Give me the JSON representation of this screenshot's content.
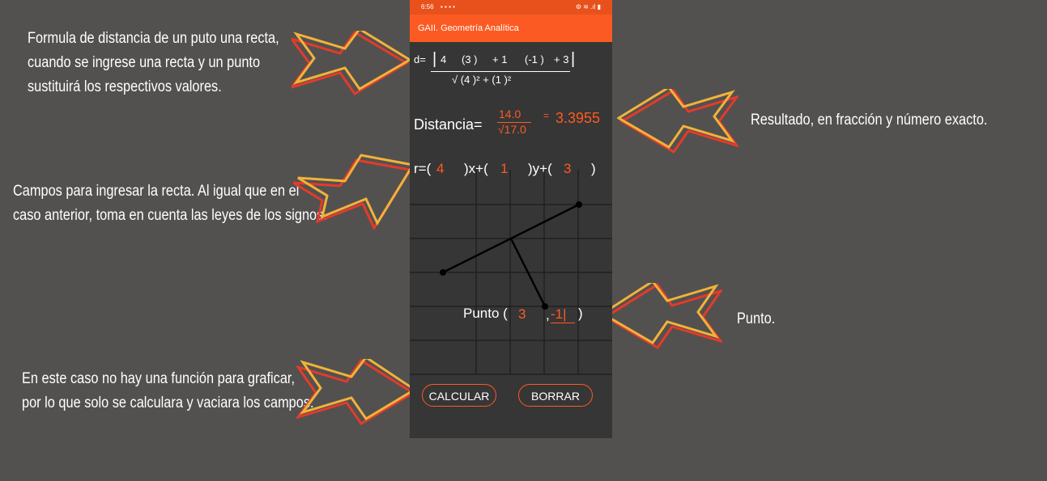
{
  "annotations": {
    "formula": [
      "Formula de distancia de un puto una recta,",
      "cuando se ingrese una recta y un punto",
      "sustituirá los respectivos valores."
    ],
    "result": [
      "Resultado, en fracción y número exacto."
    ],
    "fields": [
      "Campos para ingresar la recta. Al igual que en el",
      "caso anterior, toma en cuenta las leyes de los signos."
    ],
    "point": [
      "Punto."
    ],
    "graph": [
      "En este caso no hay una función para graficar,",
      "por lo que solo se calculara y vaciara los campos."
    ]
  },
  "status_bar": {
    "time": "6:56",
    "icons": "▪ ▪ ▪ •",
    "right": "⚙ ≋ .ıl ▮"
  },
  "app_bar": {
    "title": "GAII. Geometría Analítica"
  },
  "formula": {
    "prefix": "d=",
    "numerator": "4 (3 ) + 1 (-1 ) + 3",
    "a": "4",
    "x": "(3 )",
    "plus1": "+ 1",
    "y": "(-1 )",
    "plus3": "+ 3",
    "denominator": "√ (4 )² + (1 )²"
  },
  "distance": {
    "label": "Distancia=",
    "frac_num": "14.0",
    "frac_den": "√17.0",
    "equals": "=",
    "value": "3.3955"
  },
  "line_input": {
    "prefix": "r=(",
    "a": "4",
    "x_part": ")x+(",
    "b": "1",
    "y_part": ")y+(",
    "c": "3",
    "close": ")"
  },
  "point_input": {
    "label": "Punto (",
    "x": "3",
    "sep": ",",
    "y": "-1|",
    "close": ")"
  },
  "buttons": {
    "calculate": "CALCULAR",
    "clear": "BORRAR"
  },
  "colors": {
    "accent": "#ff5a1f",
    "appbar": "#fb5a22",
    "background": "#363636",
    "page": "#525150"
  }
}
